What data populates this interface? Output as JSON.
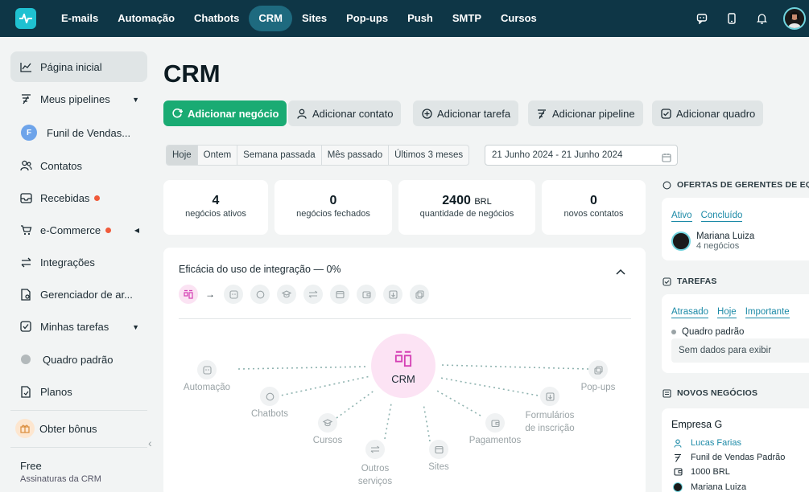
{
  "colors": {
    "nav_bg": "#0e3646",
    "nav_active": "#1e6a7f",
    "primary_button": "#1aab73",
    "accent_link": "#1c8aa7",
    "crm_hub": "#fce3f4",
    "notification_dot": "#f05a3a"
  },
  "topnav": {
    "logo_icon": "pulse-logo-icon",
    "links": [
      "E-mails",
      "Automação",
      "Chatbots",
      "CRM",
      "Sites",
      "Pop-ups",
      "Push",
      "SMTP",
      "Cursos"
    ],
    "active": "CRM",
    "icons": [
      "chat-icon",
      "mobile-icon",
      "bell-icon",
      "avatar"
    ]
  },
  "sidebar": {
    "items": [
      {
        "label": "Página inicial",
        "icon": "chart-line-icon"
      },
      {
        "label": "Meus pipelines",
        "icon": "pipeline-icon"
      },
      {
        "label": "Funil de Vendas...",
        "badge": "F"
      },
      {
        "label": "Contatos",
        "icon": "contacts-icon"
      },
      {
        "label": "Recebidas",
        "icon": "inbox-icon"
      },
      {
        "label": "e-Commerce",
        "icon": "cart-icon"
      },
      {
        "label": "Integrações",
        "icon": "integrations-icon"
      },
      {
        "label": "Gerenciador de ar...",
        "icon": "file-manager-icon"
      },
      {
        "label": "Minhas tarefas",
        "icon": "tasks-icon"
      },
      {
        "label": "Quadro padrão"
      },
      {
        "label": "Planos",
        "icon": "plans-icon"
      },
      {
        "label": "Obter bônus",
        "icon": "gift-icon"
      }
    ],
    "plan_name": "Free",
    "plan_sub": "Assinaturas da CRM"
  },
  "main": {
    "title": "CRM",
    "actions": [
      "Adicionar negócio",
      "Adicionar contato",
      "Adicionar tarefa",
      "Adicionar pipeline",
      "Adicionar quadro"
    ],
    "periods": [
      "Hoje",
      "Ontem",
      "Semana passada",
      "Mês passado",
      "Últimos 3 meses"
    ],
    "selected_period": "Hoje",
    "date_range": "21 Junho 2024 - 21 Junho 2024",
    "stats": [
      {
        "value": "4",
        "unit": "",
        "label": "negócios ativos"
      },
      {
        "value": "0",
        "unit": "",
        "label": "negócios fechados"
      },
      {
        "value": "2400",
        "unit": "BRL",
        "label": "quantidade de negócios"
      },
      {
        "value": "0",
        "unit": "",
        "label": "novos contatos"
      }
    ],
    "integration": {
      "title": "Eficácia do uso de integração — 0%",
      "hub_label": "CRM",
      "nodes": {
        "automacao": "Automação",
        "chatbots": "Chatbots",
        "cursos": "Cursos",
        "outros_1": "Outros",
        "outros_2": "serviços",
        "sites": "Sites",
        "pagamentos": "Pagamentos",
        "formularios_1": "Formulários",
        "formularios_2": "de inscrição",
        "popups": "Pop-ups"
      }
    }
  },
  "right": {
    "offers": {
      "title": "OFERTAS DE GERENTES DE EQ",
      "tabs": [
        "Ativo",
        "Concluído"
      ],
      "person_name": "Mariana Luiza",
      "person_sub": "4 negócios"
    },
    "tasks": {
      "title": "TAREFAS",
      "tabs": [
        "Atrasado",
        "Hoje",
        "Importante"
      ],
      "board": "Quadro padrão",
      "empty": "Sem dados para exibir"
    },
    "new_deals": {
      "title": "NOVOS NEGÓCIOS",
      "company": "Empresa G",
      "contact": "Lucas Farias",
      "pipeline": "Funil de Vendas Padrão",
      "amount": "1000 BRL",
      "owner": "Mariana Luiza"
    }
  }
}
